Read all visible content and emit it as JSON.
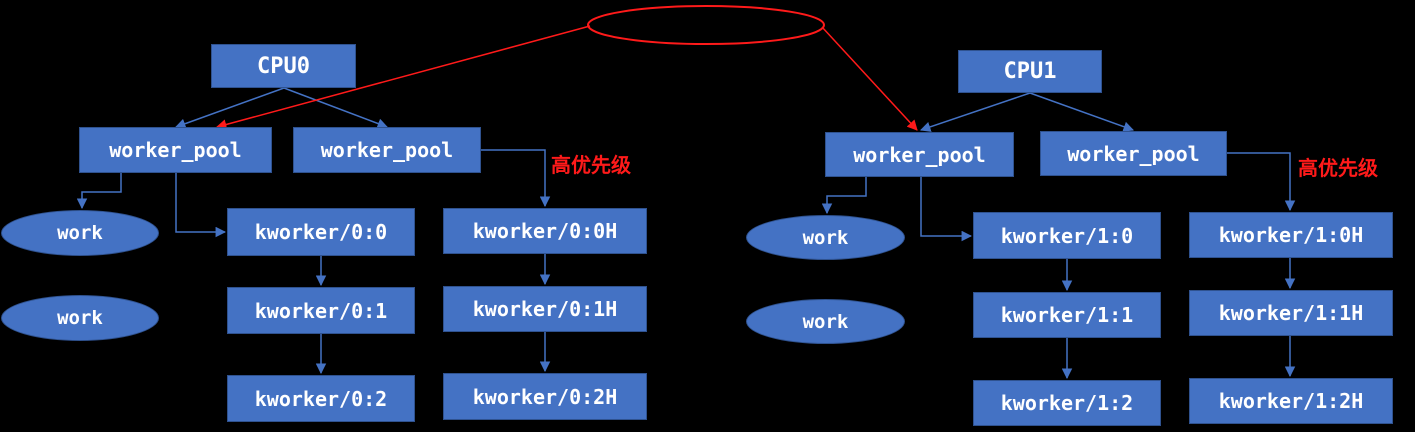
{
  "colors": {
    "node_fill": "#4472c4",
    "node_border": "#2f528f",
    "connector": "#4472c4",
    "highlight": "#ff1a1a",
    "background": "#000000"
  },
  "cpus": [
    {
      "cpu_label": "CPU0",
      "normal_pool": {
        "label": "worker_pool",
        "works": [
          "work",
          "work"
        ],
        "kworkers": [
          "kworker/0:0",
          "kworker/0:1",
          "kworker/0:2"
        ]
      },
      "high_pool": {
        "label": "worker_pool",
        "priority_label": "高优先级",
        "kworkers": [
          "kworker/0:0H",
          "kworker/0:1H",
          "kworker/0:2H"
        ]
      }
    },
    {
      "cpu_label": "CPU1",
      "normal_pool": {
        "label": "worker_pool",
        "works": [
          "work",
          "work"
        ],
        "kworkers": [
          "kworker/1:0",
          "kworker/1:1",
          "kworker/1:2"
        ]
      },
      "high_pool": {
        "label": "worker_pool",
        "priority_label": "高优先级",
        "kworkers": [
          "kworker/1:0H",
          "kworker/1:1H",
          "kworker/1:2H"
        ]
      }
    }
  ]
}
